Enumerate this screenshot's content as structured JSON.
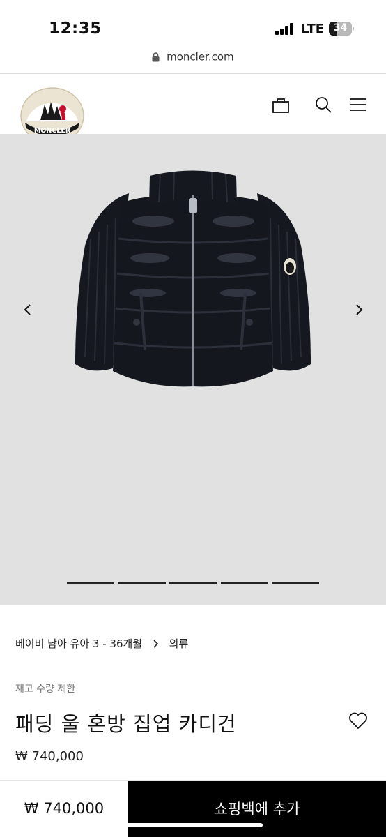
{
  "status_bar": {
    "time": "12:35",
    "network": "LTE",
    "battery": "34",
    "icons": [
      "signal-icon",
      "battery-icon"
    ]
  },
  "browser": {
    "url": "moncler.com",
    "icons": [
      "lock-icon"
    ]
  },
  "header": {
    "logo_text": "MONCLER",
    "icons": [
      "shopping-bag-icon",
      "search-icon",
      "menu-icon"
    ]
  },
  "gallery": {
    "icons": [
      "chevron-left-icon",
      "chevron-right-icon"
    ],
    "slide_count": 5,
    "active_slide": 1
  },
  "product": {
    "breadcrumb": [
      "베이비 남아 유아 3 - 36개월",
      "의류"
    ],
    "stock_note": "재고 수량 제한",
    "title": "패딩 울 혼방 집업 카디건",
    "price": "₩ 740,000"
  },
  "bottom_bar": {
    "price": "₩ 740,000",
    "add_button_label": "쇼핑백에 추가"
  },
  "colors": {
    "gallery_bg": "#e1e1e1",
    "button_bg": "#000000",
    "brand_red": "#c8102e"
  }
}
